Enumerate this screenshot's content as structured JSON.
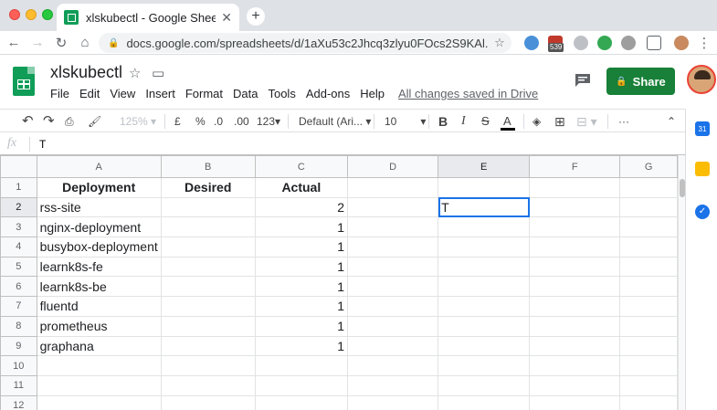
{
  "browser": {
    "tab_title": "xlskubectl - Google Sheets",
    "tab_close": "✕",
    "new_tab": "+",
    "url": "docs.google.com/spreadsheets/d/1aXu53c2Jhcq3zlyu0FOcs2S9KAl...",
    "extension_badge": "539",
    "colors": {
      "chrome_bg": "#dee1e6",
      "omnibox_bg": "#f1f3f4"
    }
  },
  "app": {
    "doc_title": "xlskubectl",
    "menu": [
      "File",
      "Edit",
      "View",
      "Insert",
      "Format",
      "Data",
      "Tools",
      "Add-ons",
      "Help"
    ],
    "save_status": "All changes saved in Drive",
    "share_label": "Share",
    "colors": {
      "share": "#188038",
      "selection": "#1a73e8"
    }
  },
  "toolbar": {
    "zoom": "125%",
    "currency": "£",
    "percent": "%",
    "decrease_decimals": ".0",
    "increase_decimals": ".00",
    "more_formats": "123",
    "font": "Default (Ari...",
    "font_size": "10",
    "bold": "B",
    "italic": "I",
    "strike": "S",
    "text_color": "A",
    "more": "···"
  },
  "formula_bar": {
    "fx": "fx",
    "value": "T"
  },
  "sheet": {
    "columns": [
      "A",
      "B",
      "C",
      "D",
      "E",
      "F",
      "G"
    ],
    "rows": [
      {
        "n": "1",
        "a": "Deployment",
        "b": "Desired",
        "c": "Actual",
        "e": ""
      },
      {
        "n": "2",
        "a": "rss-site",
        "b": "",
        "c": "2",
        "e": "T"
      },
      {
        "n": "3",
        "a": "nginx-deployment",
        "b": "",
        "c": "1",
        "e": ""
      },
      {
        "n": "4",
        "a": "busybox-deployment",
        "b": "",
        "c": "1",
        "e": ""
      },
      {
        "n": "5",
        "a": "learnk8s-fe",
        "b": "",
        "c": "1",
        "e": ""
      },
      {
        "n": "6",
        "a": "learnk8s-be",
        "b": "",
        "c": "1",
        "e": ""
      },
      {
        "n": "7",
        "a": "fluentd",
        "b": "",
        "c": "1",
        "e": ""
      },
      {
        "n": "8",
        "a": "prometheus",
        "b": "",
        "c": "1",
        "e": ""
      },
      {
        "n": "9",
        "a": "graphana",
        "b": "",
        "c": "1",
        "e": ""
      },
      {
        "n": "10",
        "a": "",
        "b": "",
        "c": "",
        "e": ""
      },
      {
        "n": "11",
        "a": "",
        "b": "",
        "c": "",
        "e": ""
      },
      {
        "n": "12",
        "a": "",
        "b": "",
        "c": "",
        "e": ""
      }
    ],
    "active_cell": "E2",
    "selected_column": "E",
    "selected_row": "2"
  },
  "side_panel": {
    "calendar_label": "31"
  }
}
